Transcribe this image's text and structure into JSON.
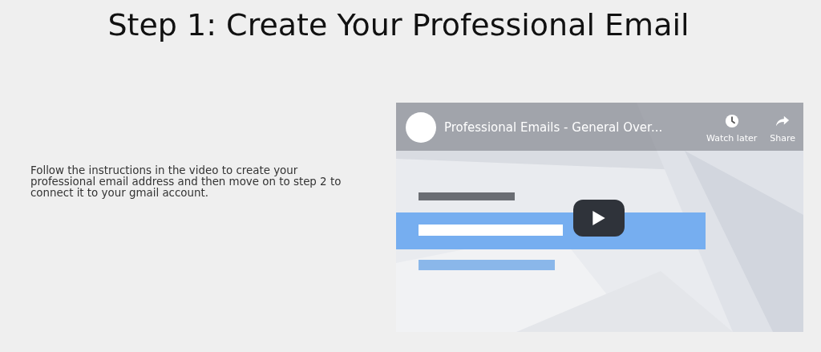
{
  "heading": "Step 1: Create Your Professional Email",
  "description": "Follow the instructions in the video to create your professional email address and then move on to step 2 to connect it to your gmail account.",
  "video": {
    "kind": "picture",
    "title": "Professional Emails - General Over...",
    "actions": [
      {
        "kind": "clock",
        "label": "Watch later"
      },
      {
        "kind": "share",
        "label": "Share"
      }
    ]
  }
}
